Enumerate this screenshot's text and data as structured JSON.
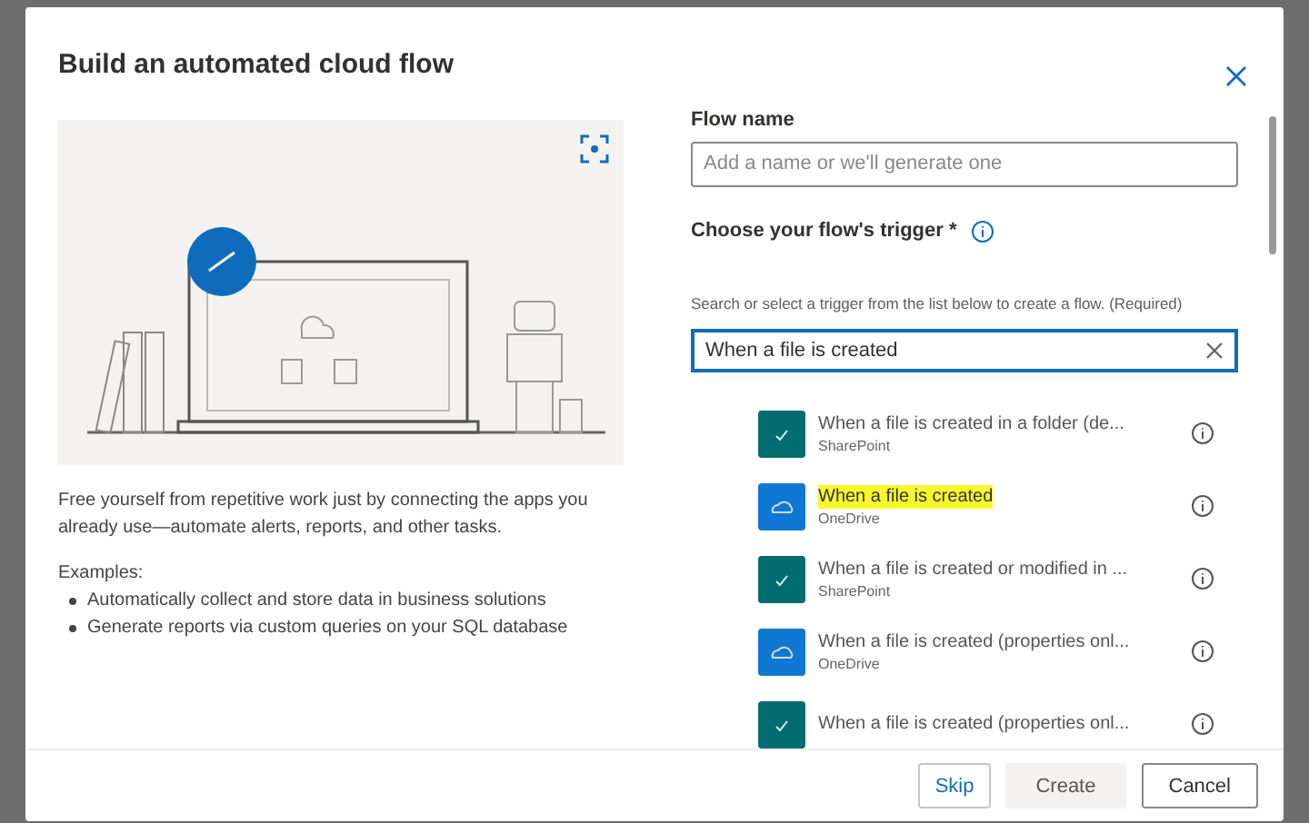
{
  "dialog": {
    "title": "Build an automated cloud flow",
    "description": "Free yourself from repetitive work just by connecting the apps you already use—automate alerts, reports, and other tasks.",
    "examples_label": "Examples:",
    "examples": [
      "Automatically collect and store data in business solutions",
      "Generate reports via custom queries on your SQL database"
    ],
    "flow_name": {
      "label": "Flow name",
      "placeholder": "Add a name or we'll generate one"
    },
    "trigger": {
      "label": "Choose your flow's trigger *",
      "hint": "Search or select a trigger from the list below to create a flow. (Required)",
      "search_value": "When a file is created"
    },
    "triggers": [
      {
        "kind": "sharepoint",
        "title": "When a file is created in a folder (de...",
        "source": "SharePoint",
        "highlighted": false
      },
      {
        "kind": "onedrive",
        "title": "When a file is created",
        "source": "OneDrive",
        "highlighted": true
      },
      {
        "kind": "sharepoint",
        "title": "When a file is created or modified in ...",
        "source": "SharePoint",
        "highlighted": false
      },
      {
        "kind": "onedrive",
        "title": "When a file is created (properties onl...",
        "source": "OneDrive",
        "highlighted": false
      },
      {
        "kind": "sharepoint",
        "title": "When a file is created (properties onl...",
        "highlighted": false
      }
    ],
    "buttons": [
      {
        "label": "Skip",
        "kind": "link"
      },
      {
        "label": "Create",
        "kind": "disabled"
      },
      {
        "label": "Cancel",
        "kind": "default"
      }
    ]
  }
}
